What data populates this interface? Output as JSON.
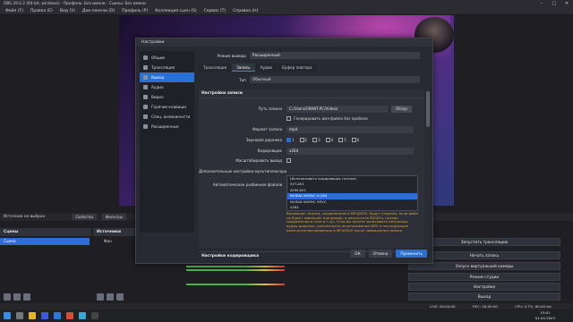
{
  "window": {
    "title": "OBS 29.0.2 (64-bit, windows) - Профиль: Без имени - Сцены: Без имени",
    "menu": [
      "Файл (F)",
      "Правка (E)",
      "Вид (V)",
      "Док-панели (D)",
      "Профиль (P)",
      "Коллекция сцен (S)",
      "Сервис (T)",
      "Справка (H)"
    ]
  },
  "source_bar": {
    "label": "Источник не выбран",
    "properties": "Свойства",
    "filters": "Фильтры"
  },
  "dialog": {
    "title": "Настройки",
    "sidebar": [
      "Общие",
      "Трансляция",
      "Вывод",
      "Аудио",
      "Видео",
      "Горячие клавиши",
      "Спец. возможности",
      "Расширенные"
    ],
    "active_sidebar": "Вывод",
    "output_mode_label": "Режим вывода",
    "output_mode_value": "Расширенный",
    "tabs": [
      "Трансляция",
      "Запись",
      "Аудио",
      "Буфер повтора"
    ],
    "active_tab": "Запись",
    "type_label": "Тип",
    "type_value": "Обычный",
    "section_record": "Настройки записи",
    "path_label": "Путь записи",
    "path_value": "C:/Users/GRANT-PC/Videos",
    "browse": "Обзор",
    "gen_name_label": "Генерировать имя файла без пробела",
    "format_label": "Формат записи",
    "format_value": "mp4",
    "tracks_label": "Звуковая дорожка",
    "tracks": [
      "1",
      "2",
      "3",
      "4",
      "5",
      "6"
    ],
    "encoder_label": "Кодировщик",
    "encoder_value": "x264",
    "rescale_label": "Масштабировать вывод",
    "muxer_label": "Дополнительные настройки мультиплексора",
    "autosplit_label": "Автоматическое разбиение файлов",
    "encoder_options": [
      "(Использовать кодировщик потока)",
      "SVT-AV1",
      "AOM AV1",
      "NVIDIA NVENC H.264",
      "NVIDIA NVENC HEVC",
      "x264"
    ],
    "highlighted_option": "NVIDIA NVENC H.264",
    "warning": "Внимание: записи, сохранённые в MP4/MOV, будут утеряны, если файл не будет завершён (например, в результате BSOD'а, потери напряжения в сети и т.д.). Если вы хотите записывать несколько аудио дорожек, рассмотрите использование MKV и последующее ремультиплексирование в MP4/MOV после завершения записи",
    "section_encoder": "Настройки кодировщика",
    "btn_ok": "ОК",
    "btn_cancel": "Отмена",
    "btn_apply": "Применить"
  },
  "docks": {
    "scenes_title": "Сцены",
    "scene_item": "Сцена",
    "sources_title": "Источники",
    "source_item": "Фон"
  },
  "controls": [
    "Запустить трансляцию",
    "Начать запись",
    "Запуск виртуальной камеры",
    "Режим студии",
    "Настройки",
    "Выход"
  ],
  "status": {
    "live": "LIVE: 00:00:00",
    "rec": "REC: 00:00:00",
    "cpu": "CPU: 0.7%, 60.00 fps"
  },
  "clock": {
    "time": "15:01",
    "date": "01.04.2023"
  }
}
